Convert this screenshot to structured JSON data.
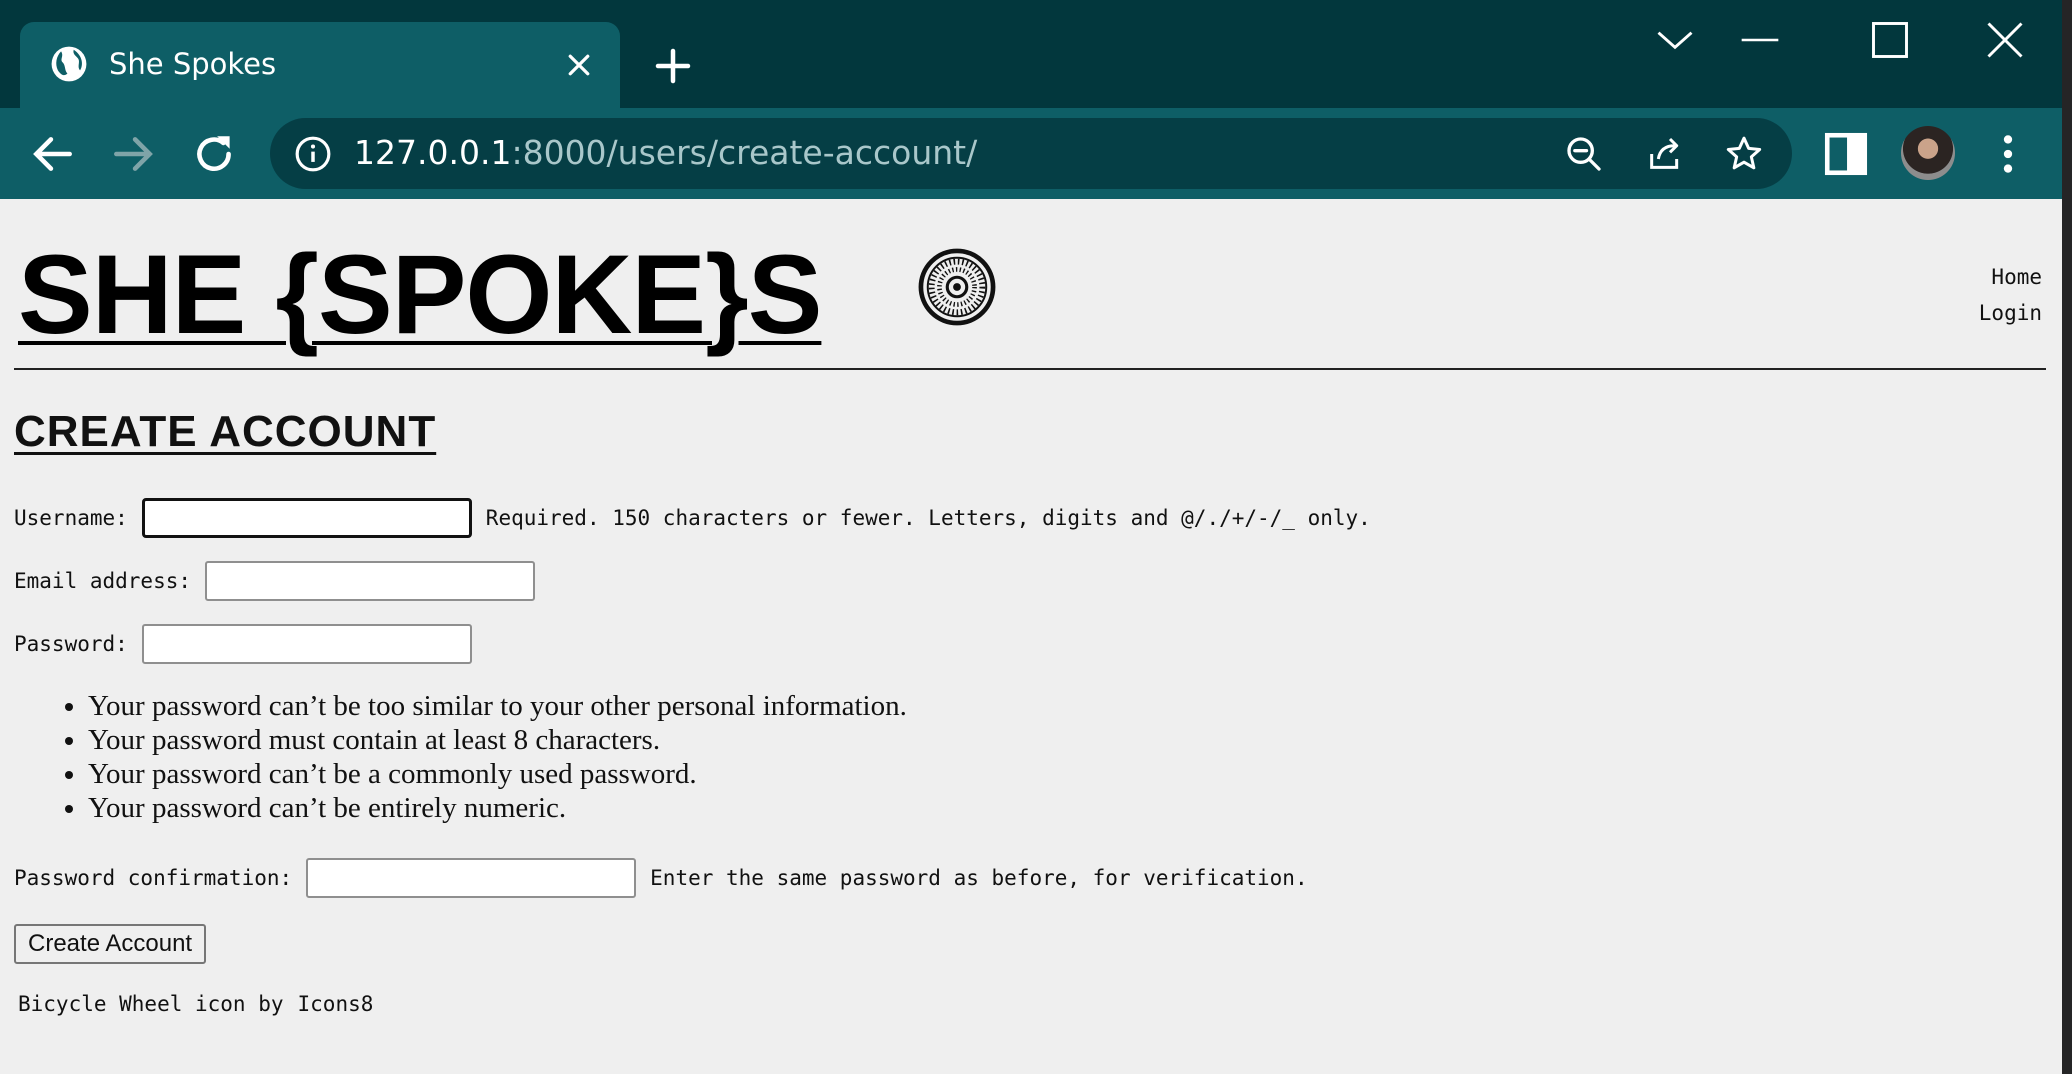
{
  "browser": {
    "tab_title": "She Spokes",
    "url_host": "127.0.0.1",
    "url_rest": ":8000/users/create-account/"
  },
  "site": {
    "logo_text": "SHE {SPOKE}S ",
    "nav": [
      "Home",
      "Login"
    ]
  },
  "form": {
    "heading": "CREATE ACCOUNT",
    "username_label": "Username:",
    "username_help": "Required. 150 characters or fewer. Letters, digits and @/./+/-/_ only.",
    "email_label": "Email address:",
    "password_label": "Password:",
    "password_rules": [
      "Your password can’t be too similar to your other personal information.",
      "Your password must contain at least 8 characters.",
      "Your password can’t be a commonly used password.",
      "Your password can’t be entirely numeric."
    ],
    "password2_label": "Password confirmation:",
    "password2_help": "Enter the same password as before, for verification.",
    "submit_label": "Create Account"
  },
  "footer": {
    "credit_text": "Bicycle Wheel icon by",
    "credit_link": "Icons8"
  },
  "icons": {
    "tab": "globe-icon",
    "close": "close-icon",
    "new_tab": "plus-icon",
    "back": "arrow-left-icon",
    "forward": "arrow-right-icon",
    "reload": "reload-icon",
    "site_info": "info-icon",
    "zoom": "zoom-icon",
    "share": "share-icon",
    "bookmark": "star-icon",
    "side_panel": "side-panel-icon",
    "menu": "kebab-menu-icon",
    "logo_mark": "bicycle-wheel-icon"
  },
  "colors": {
    "titlebar": "#02373d",
    "toolbar": "#0e5e66",
    "omnibox": "#053e45",
    "page_bg": "#efefef"
  }
}
